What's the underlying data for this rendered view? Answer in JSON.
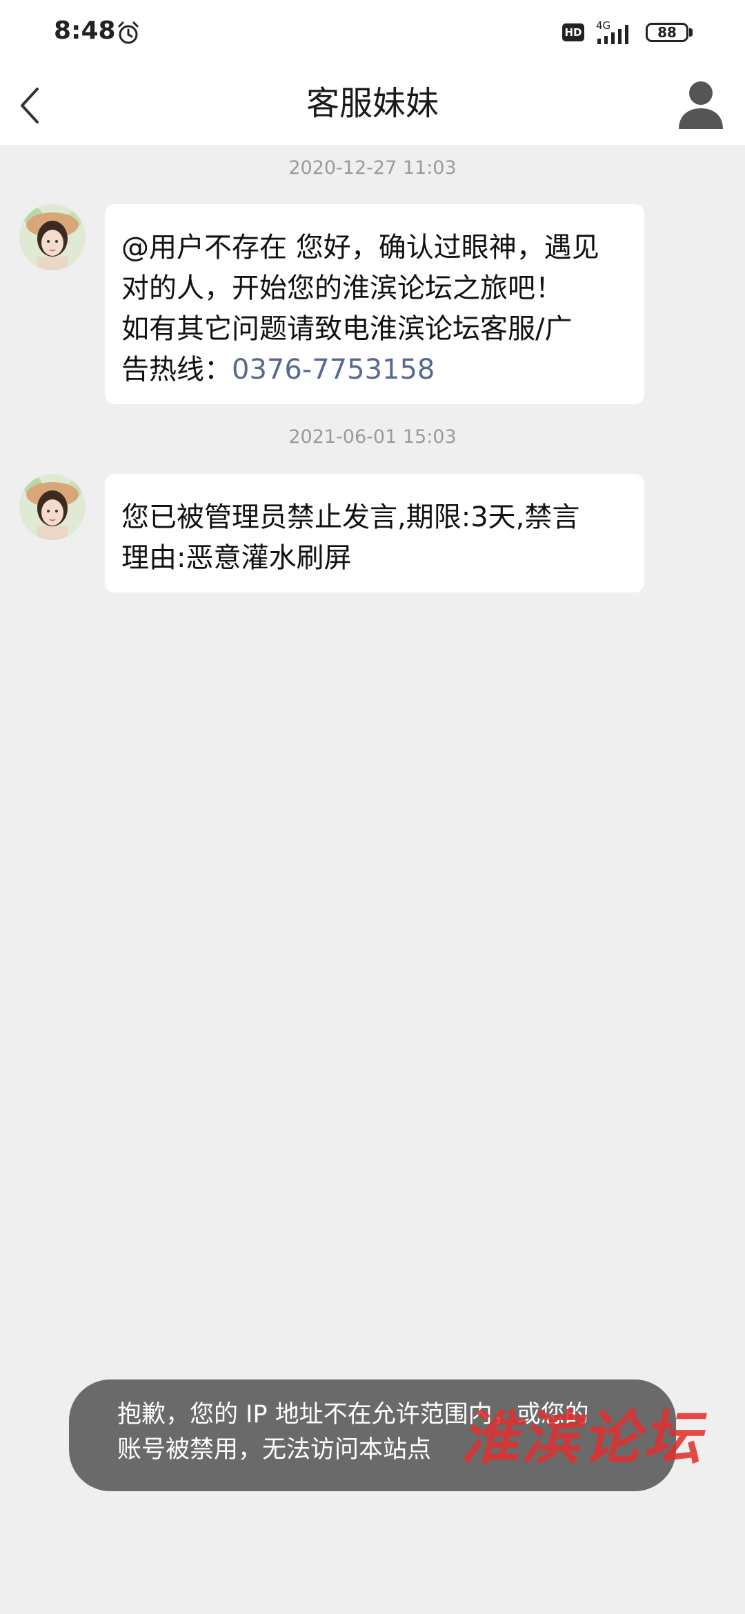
{
  "status_bar": {
    "time": "8:48",
    "hd_badge": "HD",
    "network": "4G",
    "battery": "88",
    "icons": [
      "alarm-icon",
      "signal-icon",
      "battery-icon"
    ]
  },
  "header": {
    "title": "客服妹妹",
    "back_icon": "chevron-left-icon",
    "profile_icon": "user-icon"
  },
  "messages": [
    {
      "timestamp": "2020-12-27 11:03",
      "lines": [
        "@用户不存在 您好，确认过眼神，遇见",
        "对的人，开始您的淮滨论坛之旅吧！",
        "如有其它问题请致电淮滨论坛客服/广"
      ],
      "last_line_prefix": "告热线：",
      "phone": "0376-7753158"
    },
    {
      "timestamp": "2021-06-01 15:03",
      "lines": [
        "您已被管理员禁止发言,期限:3天,禁言",
        "理由:恶意灌水刷屏"
      ]
    }
  ],
  "toast": {
    "line1": "抱歉，您的 IP 地址不在允许范围内，或您的",
    "line2": "账号被禁用，无法访问本站点"
  },
  "watermark": "淮滨论坛",
  "colors": {
    "background": "#efefef",
    "bubble": "#ffffff",
    "link": "#56698e",
    "toast": "#6a6a6a",
    "watermark": "#e0312f"
  }
}
